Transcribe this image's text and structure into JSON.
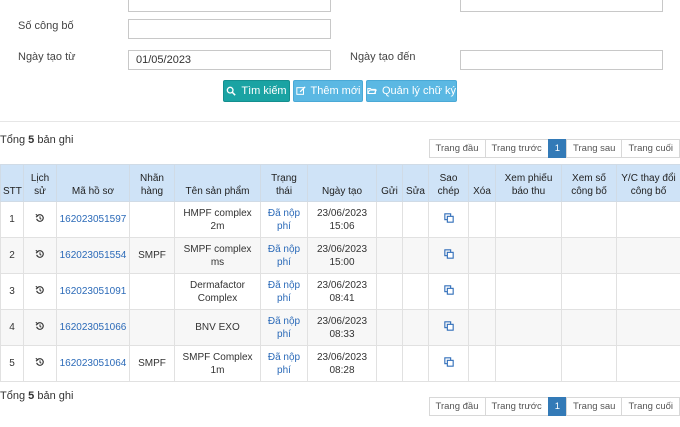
{
  "filters": {
    "so_cong_bo_label": "Số công bố",
    "ngay_tao_tu_label": "Ngày tạo từ",
    "ngay_tao_tu_value": "01/05/2023",
    "ngay_tao_den_label": "Ngày tạo đến",
    "ngay_tao_den_value": ""
  },
  "buttons": {
    "search": "Tìm kiếm",
    "add": "Thêm mới",
    "signature": "Quản lý chữ ký"
  },
  "summary": {
    "prefix": "Tổng",
    "count": "5",
    "suffix": "bản ghi"
  },
  "pager": {
    "first": "Trang đầu",
    "prev": "Trang trước",
    "current": "1",
    "next": "Trang sau",
    "last": "Trang cuối"
  },
  "table": {
    "headers": {
      "stt": "STT",
      "lich_su": "Lịch sử",
      "ma_ho_so": "Mã hồ sơ",
      "nhan_hang": "Nhãn hàng",
      "ten_san_pham": "Tên sản phẩm",
      "trang_thai": "Trạng thái",
      "ngay_tao": "Ngày tạo",
      "gui": "Gửi",
      "sua": "Sửa",
      "sao_chep": "Sao chép",
      "xoa": "Xóa",
      "xem_phieu": "Xem phiếu báo thu",
      "xem_so": "Xem số công bố",
      "yc": "Y/C thay đổi công bố"
    },
    "rows": [
      {
        "stt": "1",
        "ma": "162023051597",
        "nhan": "",
        "ten": "HMPF complex 2m",
        "trang_thai": "Đã nộp phí",
        "ngay": "23/06/2023 15:06"
      },
      {
        "stt": "2",
        "ma": "162023051554",
        "nhan": "SMPF",
        "ten": "SMPF complex ms",
        "trang_thai": "Đã nộp phí",
        "ngay": "23/06/2023 15:00"
      },
      {
        "stt": "3",
        "ma": "162023051091",
        "nhan": "",
        "ten": "Dermafactor Complex",
        "trang_thai": "Đã nộp phí",
        "ngay": "23/06/2023 08:41"
      },
      {
        "stt": "4",
        "ma": "162023051066",
        "nhan": "",
        "ten": "BNV EXO",
        "trang_thai": "Đã nộp phí",
        "ngay": "23/06/2023 08:33"
      },
      {
        "stt": "5",
        "ma": "162023051064",
        "nhan": "SMPF",
        "ten": "SMPF Complex 1m",
        "trang_thai": "Đã nộp phí",
        "ngay": "23/06/2023 08:28"
      }
    ]
  },
  "colors": {
    "primary_teal": "#1aa3a3",
    "info_blue": "#5bb8e3",
    "header_bg": "#cfe3f7",
    "link": "#2b6ab8"
  },
  "icons": {
    "history": "history-icon",
    "copy": "copy-icon",
    "search": "search-icon",
    "edit": "edit-icon",
    "folder": "folder-open-icon"
  }
}
